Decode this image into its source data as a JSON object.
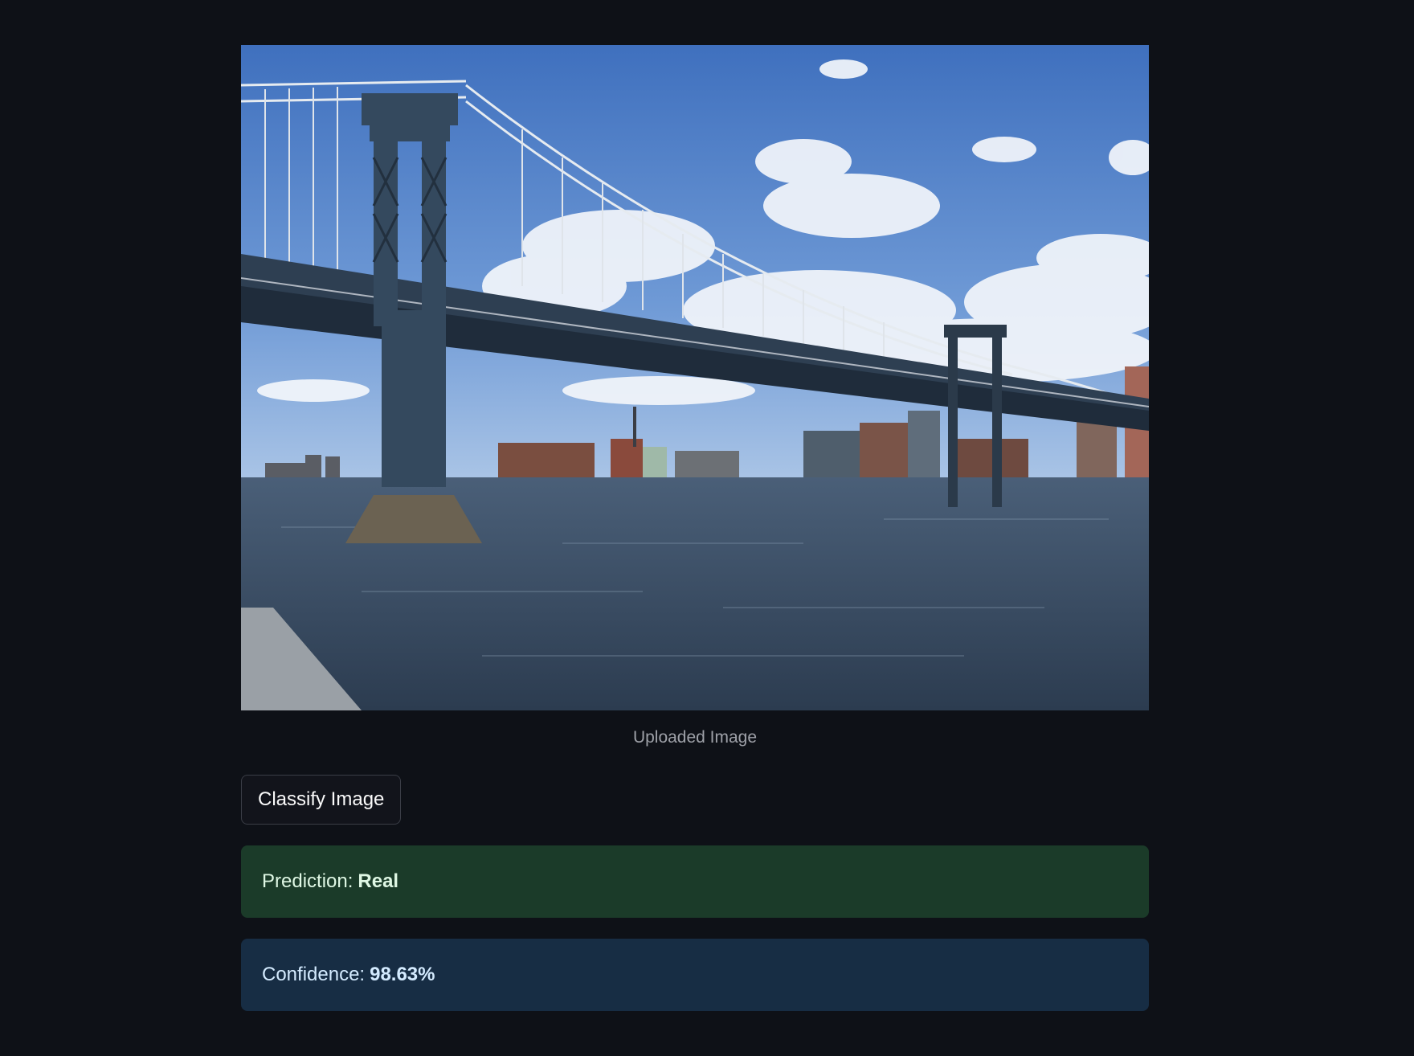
{
  "image": {
    "icon": "photo-bridge-river",
    "caption": "Uploaded Image"
  },
  "actions": {
    "classify_label": "Classify Image"
  },
  "prediction": {
    "label": "Prediction:",
    "value": "Real",
    "color": "#1b3b29"
  },
  "confidence": {
    "label": "Confidence:",
    "value": "98.63%",
    "color": "#172d44"
  },
  "theme": {
    "background": "#0e1117"
  }
}
